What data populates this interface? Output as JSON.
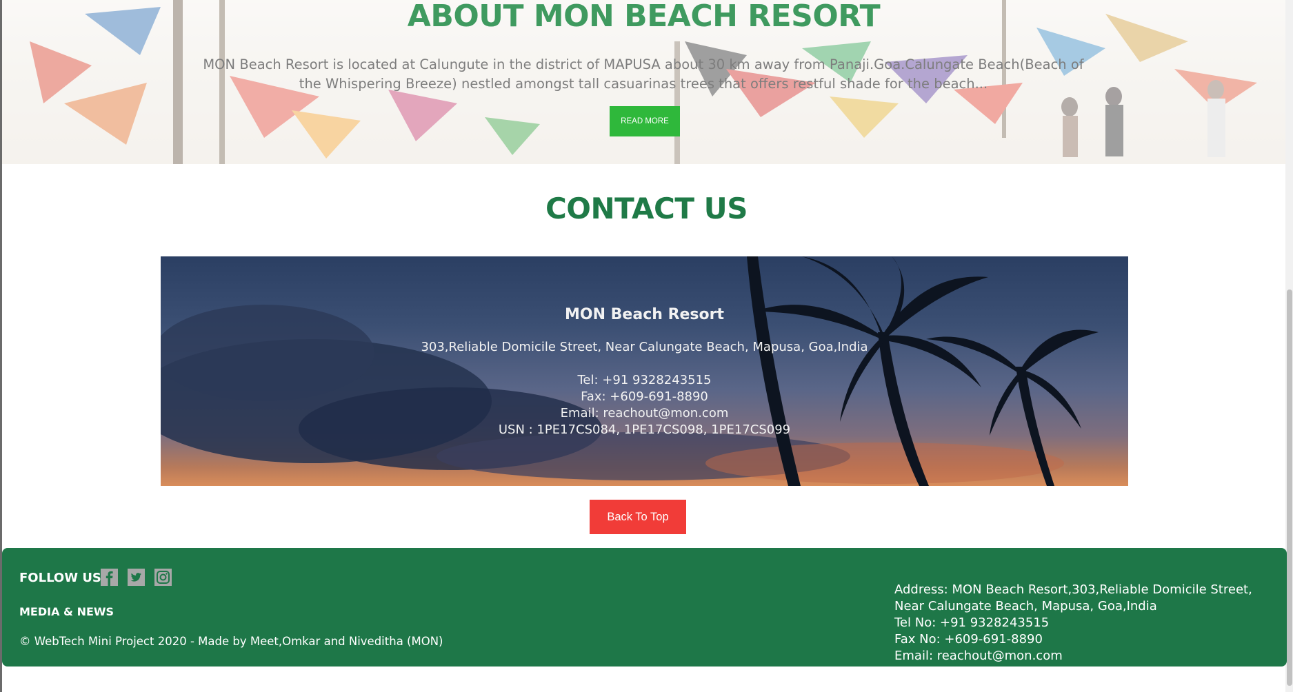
{
  "about": {
    "title": "ABOUT MON BEACH RESORT",
    "text": "MON Beach Resort is located at Calungute in the district of MAPUSA about 30 km away from Panaji.Goa.Calungate Beach(Beach of the Whispering Breeze) nestled amongst tall casuarinas trees that offers restful shade for the beach...",
    "read_more_label": "READ MORE"
  },
  "contact": {
    "title": "CONTACT US",
    "resort_name": "MON Beach Resort",
    "address": "303,Reliable Domicile Street, Near Calungate Beach, Mapusa, Goa,India",
    "tel": "Tel: +91 9328243515",
    "fax": "Fax: +609-691-8890",
    "email": "Email: reachout@mon.com",
    "usn": "USN : 1PE17CS084, 1PE17CS098, 1PE17CS099"
  },
  "back_to_top_label": "Back To Top",
  "footer": {
    "follow_label": "FOLLOW US",
    "social": [
      "facebook-icon",
      "twitter-icon",
      "instagram-icon"
    ],
    "media_label": "MEDIA & NEWS",
    "copyright": "© WebTech Mini Project 2020 - Made by Meet,Omkar and Niveditha (MON)",
    "address": "Address: MON Beach Resort,303,Reliable Domicile Street, Near Calungate Beach, Mapusa, Goa,India",
    "tel": "Tel No: +91 9328243515",
    "fax": "Fax No: +609-691-8890",
    "email": "Email: reachout@mon.com"
  },
  "colors": {
    "heading_green": "#1f7a47",
    "about_title_green": "#3f9a5f",
    "read_more_green": "#2fb83b",
    "back_to_top_red": "#f13c38",
    "footer_green": "#1e7748"
  }
}
